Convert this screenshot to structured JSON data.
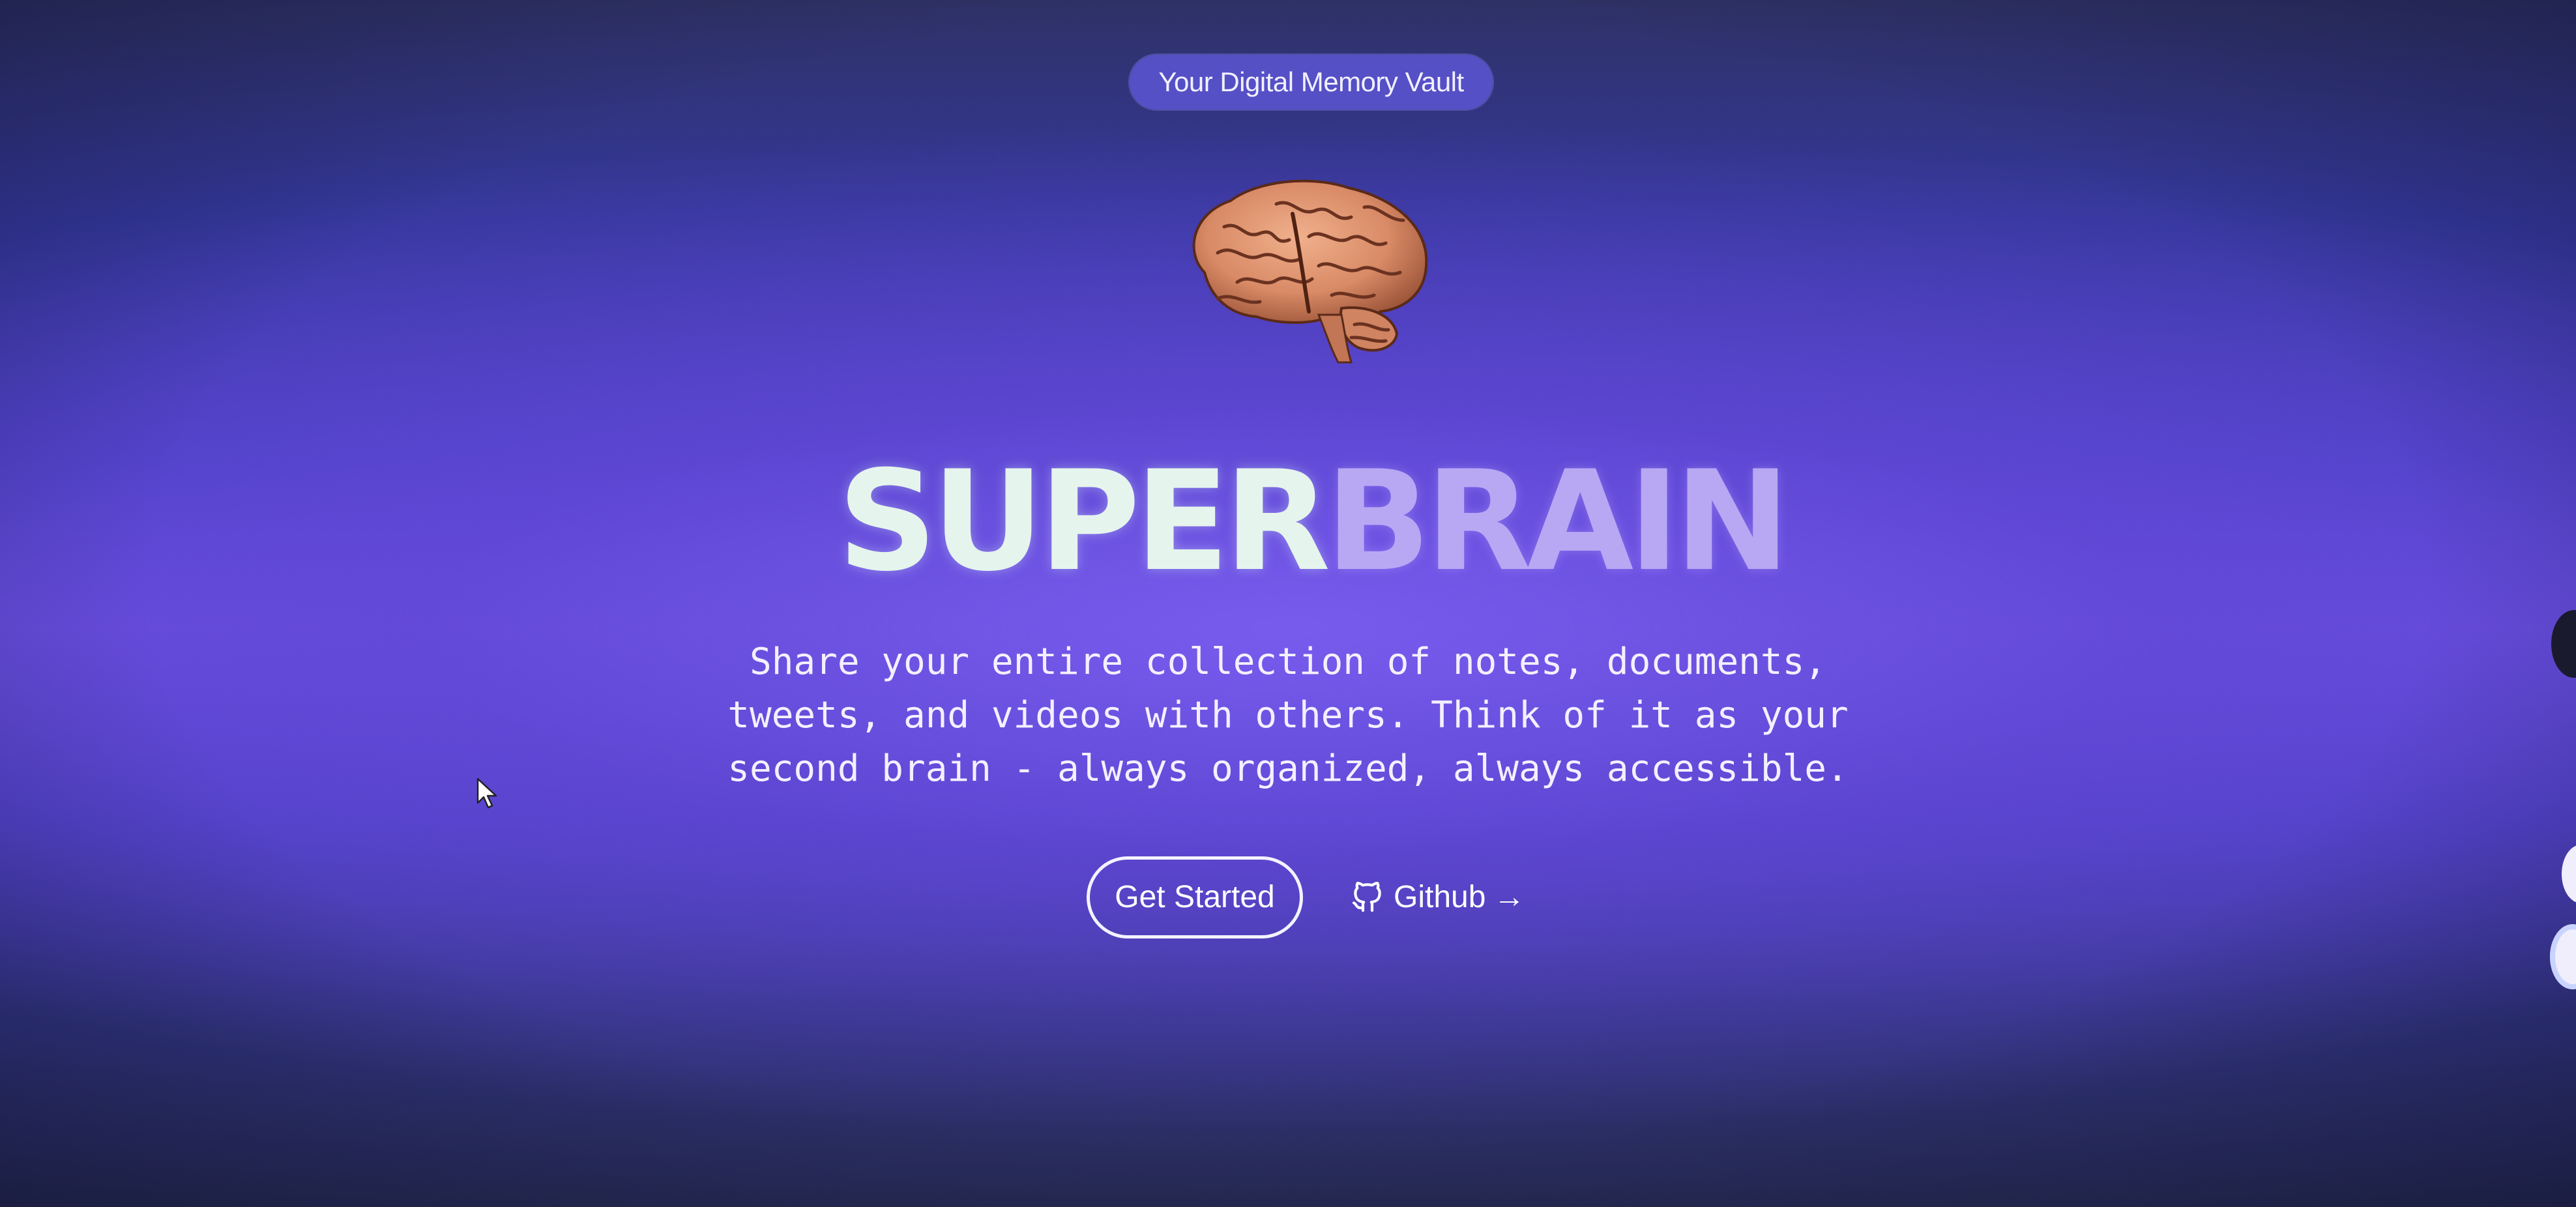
{
  "badge": {
    "label": "Your Digital Memory Vault"
  },
  "hero": {
    "title_part1": "SUPER",
    "title_part2": "BRAIN",
    "description": "Share your entire collection of notes, documents, tweets, and videos with others. Think of it as your second brain - always organized, always accessible."
  },
  "actions": {
    "get_started_label": "Get Started",
    "github_label": "Github",
    "github_arrow": "→"
  },
  "icons": {
    "brain": "brain-icon",
    "github": "github-icon",
    "cursor": "mouse-pointer-icon"
  },
  "colors": {
    "title_super": "#e6f4ee",
    "title_brain": "#b8a8f4",
    "background_mid": "#6a4fe0",
    "background_edge": "#2f3266"
  }
}
